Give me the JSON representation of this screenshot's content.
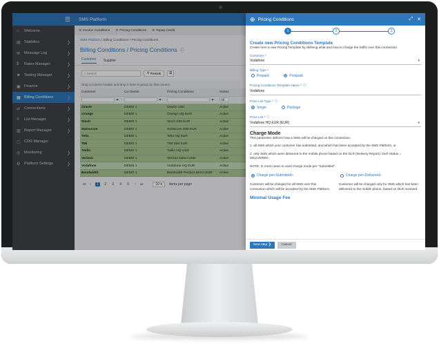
{
  "sidebar": {
    "items": [
      {
        "icon": "home-icon",
        "glyph": "⌂",
        "label": "Welcome",
        "chevron": false,
        "active": false
      },
      {
        "icon": "chart-icon",
        "glyph": "▤",
        "label": "Statistics",
        "chevron": true,
        "active": false
      },
      {
        "icon": "message-icon",
        "glyph": "✉",
        "label": "Message Log",
        "chevron": true,
        "active": false
      },
      {
        "icon": "rates-icon",
        "glyph": "$",
        "label": "Rates Manager",
        "chevron": true,
        "active": false
      },
      {
        "icon": "testing-icon",
        "glyph": "⚑",
        "label": "Testing Manager",
        "chevron": true,
        "active": false
      },
      {
        "icon": "finance-icon",
        "glyph": "▣",
        "label": "Finance",
        "chevron": true,
        "active": false
      },
      {
        "icon": "billing-icon",
        "glyph": "▦",
        "label": "Billing Conditions",
        "chevron": true,
        "active": true
      },
      {
        "icon": "connections-icon",
        "glyph": "⇄",
        "label": "Connections",
        "chevron": true,
        "active": false
      },
      {
        "icon": "list-icon",
        "glyph": "≡",
        "label": "List Manager",
        "chevron": true,
        "active": false
      },
      {
        "icon": "report-icon",
        "glyph": "▥",
        "label": "Report Manager",
        "chevron": true,
        "active": false
      },
      {
        "icon": "cdr-icon",
        "glyph": "▢",
        "label": "CDR Manager",
        "chevron": false,
        "active": false
      },
      {
        "icon": "monitoring-icon",
        "glyph": "◎",
        "label": "Monitoring",
        "chevron": true,
        "active": false
      },
      {
        "icon": "settings-icon",
        "glyph": "⚙",
        "label": "Platform Settings",
        "chevron": true,
        "active": false
      }
    ]
  },
  "main": {
    "app_title": "SMS Platform",
    "actions": [
      "Invoice Conditions",
      "Pricing Conditions",
      "Topup Credit"
    ],
    "breadcrumb": [
      "SMS Platform",
      "Billing Conditions",
      "Pricing Conditions"
    ],
    "page_title": "Billing Conditions / Pricing Conditions",
    "tabs": [
      "Customer",
      "Supplier"
    ],
    "search_placeholder": "Search",
    "presets_label": "Presets",
    "group_hint": "Drag a column header and drop it here to group by that column",
    "columns": [
      "Customer",
      "Co-Owner",
      "Pricing Conditions",
      "Status"
    ],
    "filter_select": "All",
    "rows": [
      [
        "Oracle",
        "DEMO 1",
        "Oracle USD",
        "Active"
      ],
      [
        "Orange",
        "DEMO 1",
        "Orange HQ EUR",
        "Active"
      ],
      [
        "Sinch",
        "DEMO 1",
        "Sinch SIM EUR",
        "Active"
      ],
      [
        "Swisscom",
        "DEMO 1",
        "Swisscom SIM EUR",
        "Active"
      ],
      [
        "Telia",
        "DEMO 1",
        "Telia HQ EUR",
        "Active"
      ],
      [
        "TIM",
        "DEMO 1",
        "TIM SIM EUR",
        "Active"
      ],
      [
        "Twilio",
        "DEMO 1",
        "Twilio HQ USD",
        "Active"
      ],
      [
        "Verizon",
        "DEMO 1",
        "Verizon Direct USD",
        "Active"
      ],
      [
        "Vodafone",
        "DEMO 1",
        "Vodafone HQ EUR",
        "Active"
      ],
      [
        "Bandwidth",
        "DEMO 1",
        "Bandwidth Product Direct EUR",
        "Active"
      ]
    ],
    "pager": {
      "pages": [
        "1",
        "2",
        "3",
        "4",
        "5"
      ],
      "current": "1",
      "page_size": "10",
      "items_label": "items per page"
    }
  },
  "dialog": {
    "title": "Pricing Conditions",
    "steps": [
      "1",
      "2",
      "3"
    ],
    "heading": "Create new Pricing Conditions Template",
    "intro": "Create here a new Pricing Template by defining what and how to charge the traffic over this connection.",
    "customer_label": "Customer *",
    "customer_value": "Vodafone",
    "billing_type_label": "Billing Type *",
    "billing_types": [
      "Prepaid",
      "Postpaid"
    ],
    "billing_type_selected": "Postpaid",
    "template_name_label": "Pricing Conditions Template Name *",
    "template_name_value": "Vodafone",
    "price_list_type_label": "Price List Type *",
    "price_list_types": [
      "Single",
      "Package"
    ],
    "price_list_type_selected": "Single",
    "price_list_label": "Price List *",
    "price_list_value": "Vodafone HQ EUR (EUR)",
    "charge_mode_title": "Charge Mode",
    "charge_mode_desc": "This parameter defines how a SMS will be charged on this connection.",
    "charge_option_1": "1. all SMS which your customer has submitted, and which has been accepted by the SMS Platform, or",
    "charge_option_2": "2. only SMS which were delivered to the mobile phone based on the DLR (Delivery Report): DLR Status = DELIVERED.",
    "charge_note": "NOTE: In most cases is used charge mode per \"Submitted\".",
    "charge_submitted_label": "Charge per«Submitted»",
    "charge_delivered_label": "Charge per«Delivered»",
    "charge_submitted_desc": "Customer will be charged for all SMS over this connection which will be accepted by the SMS Platform.",
    "charge_delivered_desc": "Customer will be charged only for SMS which has been delivered to the mobile phone, based on DLR received.",
    "min_usage_title": "Minimal Usage Fee",
    "next_label": "Next step",
    "cancel_label": "Cancel"
  },
  "colors": {
    "accent": "#2f77bd",
    "row_green": "#a9c996",
    "sidebar_bg": "#404349"
  }
}
